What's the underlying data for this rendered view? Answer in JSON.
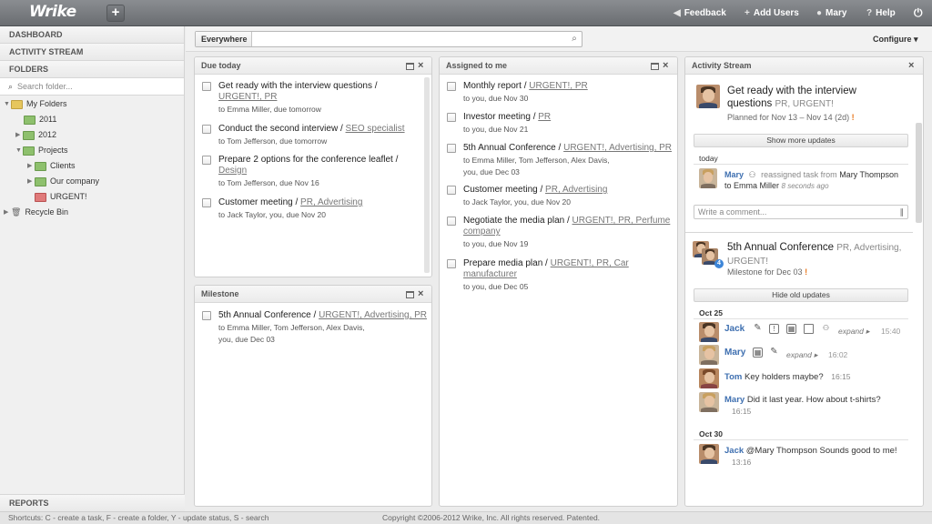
{
  "app": {
    "logo": "Wrike",
    "new_label": "+"
  },
  "topnav": {
    "feedback": "Feedback",
    "add_users": "Add Users",
    "user": "Mary",
    "help": "Help"
  },
  "sidebar": {
    "dashboard": "DASHBOARD",
    "activity_stream": "ACTIVITY STREAM",
    "folders": "FOLDERS",
    "search_placeholder": "Search folder...",
    "tree": [
      {
        "label": "My Folders"
      },
      {
        "label": "2011"
      },
      {
        "label": "2012"
      },
      {
        "label": "Projects"
      },
      {
        "label": "Clients"
      },
      {
        "label": "Our company"
      },
      {
        "label": "URGENT!"
      },
      {
        "label": "Recycle Bin"
      }
    ],
    "reports": "REPORTS"
  },
  "toolbar": {
    "scope_label": "Everywhere",
    "search_value": "",
    "configure": "Configure ▾"
  },
  "due_today": {
    "title": "Due today",
    "tasks": [
      {
        "title": "Get ready with the interview questions /",
        "tags": "URGENT!, PR",
        "meta": "to Emma Miller, due tomorrow"
      },
      {
        "title": "Conduct the second interview /",
        "tags": "SEO specialist",
        "meta": "to Tom Jefferson, due tomorrow"
      },
      {
        "title": "Prepare 2 options for the conference leaflet /",
        "tags": "Design",
        "meta": "to Tom Jefferson, due Nov 16"
      },
      {
        "title": "Customer meeting /",
        "tags": "PR, Advertising",
        "meta": "to Jack Taylor, you, due Nov 20"
      }
    ]
  },
  "milestone": {
    "title": "Milestone",
    "tasks": [
      {
        "title": "5th Annual Conference /",
        "tags": "URGENT!, Advertising, PR",
        "meta": "to Emma Miller, Tom Jefferson, Alex Davis,",
        "meta2": "you, due Dec 03"
      }
    ]
  },
  "assigned": {
    "title": "Assigned to me",
    "tasks": [
      {
        "title": "Monthly report /",
        "tags": "URGENT!, PR",
        "meta": "to you, due Nov 30"
      },
      {
        "title": "Investor meeting /",
        "tags": "PR",
        "meta": "to you, due Nov 21"
      },
      {
        "title": "5th Annual Conference /",
        "tags": "URGENT!, Advertising, PR",
        "meta": "to Emma Miller, Tom Jefferson, Alex Davis,",
        "meta2": "you, due Dec 03"
      },
      {
        "title": "Customer meeting /",
        "tags": "PR, Advertising",
        "meta": "to Jack Taylor, you, due Nov 20"
      },
      {
        "title": "Negotiate the media plan /",
        "tags": "URGENT!, PR, Perfume",
        "tags2": "company",
        "meta": "to you, due Nov 19"
      },
      {
        "title": "Prepare media plan /",
        "tags": "URGENT!, PR, Car",
        "tags2": "manufacturer",
        "meta": "to you, due Dec 05"
      }
    ]
  },
  "activity": {
    "title": "Activity Stream",
    "item1": {
      "title1": "Get ready with the interview",
      "title2": "questions",
      "tags": "PR, URGENT!",
      "planned": "Planned for Nov 13 – Nov 14 (2d)",
      "flag": "!"
    },
    "show_more": "Show more updates",
    "today": "today",
    "upd1": {
      "user": "Mary",
      "action": "reassigned task from",
      "from": "Mary Thompson",
      "to": "to Emma Miller",
      "time": "8 seconds ago"
    },
    "comment_placeholder": "Write a comment...",
    "item2": {
      "title": "5th Annual Conference",
      "tags1": "PR, Advertising,",
      "tags2": "URGENT!",
      "milestone": "Milestone for Dec 03",
      "flag": "!",
      "badge": "4"
    },
    "hide_old": "Hide old updates",
    "oct25": "Oct 25",
    "e1": {
      "user": "Jack",
      "expand": "expand ▸",
      "time": "15:40"
    },
    "e2": {
      "user": "Mary",
      "expand": "expand ▸",
      "time": "16:02"
    },
    "e3": {
      "user": "Tom",
      "text": "Key holders maybe?",
      "time": "16:15"
    },
    "e4": {
      "user": "Mary",
      "text": "Did it last year. How about t-shirts?",
      "time": "16:15"
    },
    "oct30": "Oct 30",
    "e5": {
      "user": "Jack",
      "text": "@Mary Thompson Sounds good to me!",
      "time": "13:16"
    }
  },
  "footer": {
    "shortcuts": "Shortcuts: C - create a task, F - create a folder, Y - update status, S - search",
    "copyright": "Copyright ©2006-2012 Wrike, Inc. All rights reserved. Patented."
  }
}
